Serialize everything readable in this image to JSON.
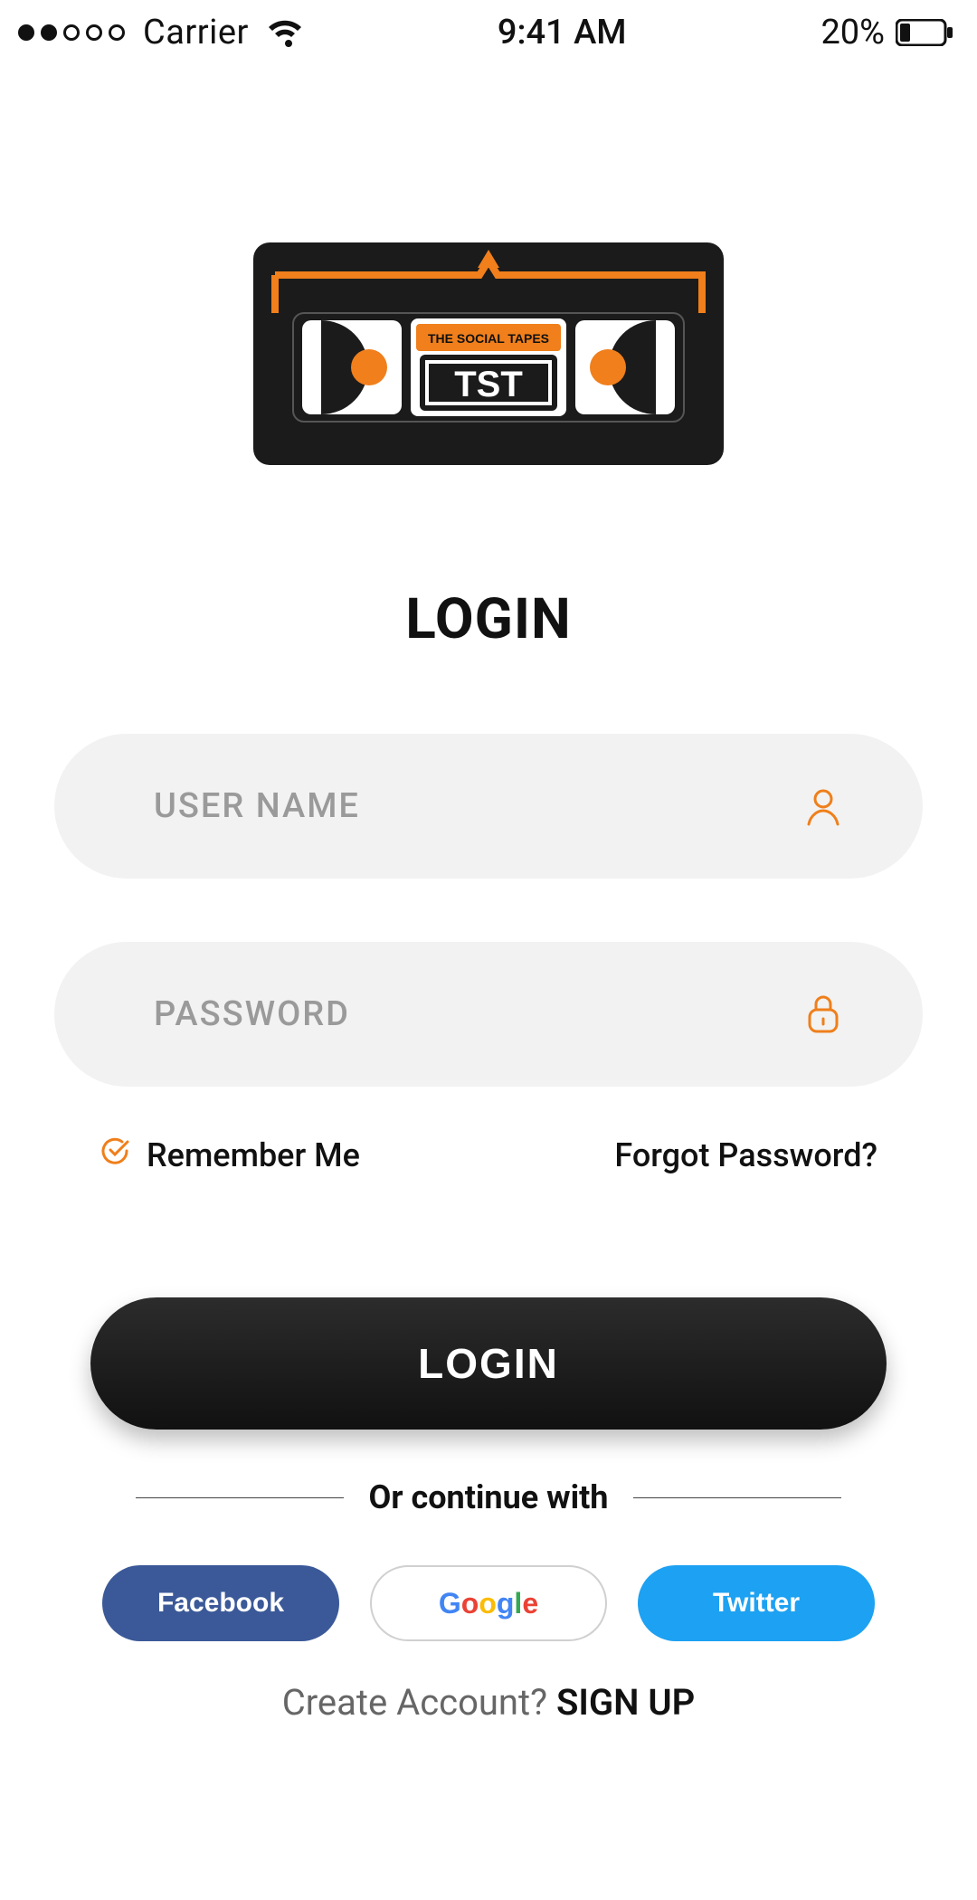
{
  "status_bar": {
    "carrier": "Carrier",
    "time": "9:41 AM",
    "battery": "20%"
  },
  "logo": {
    "title_small": "THE SOCIAL TAPES",
    "title_big": "TST"
  },
  "title": "LOGIN",
  "form": {
    "username_placeholder": "USER NAME",
    "password_placeholder": "PASSWORD",
    "remember_label": "Remember Me",
    "forgot_label": "Forgot Password?",
    "login_button": "LOGIN"
  },
  "continue_divider": "Or continue with",
  "social": {
    "facebook": "Facebook",
    "google": "Google",
    "twitter": "Twitter"
  },
  "signup": {
    "prompt": "Create Account? ",
    "link": "SIGN UP"
  }
}
